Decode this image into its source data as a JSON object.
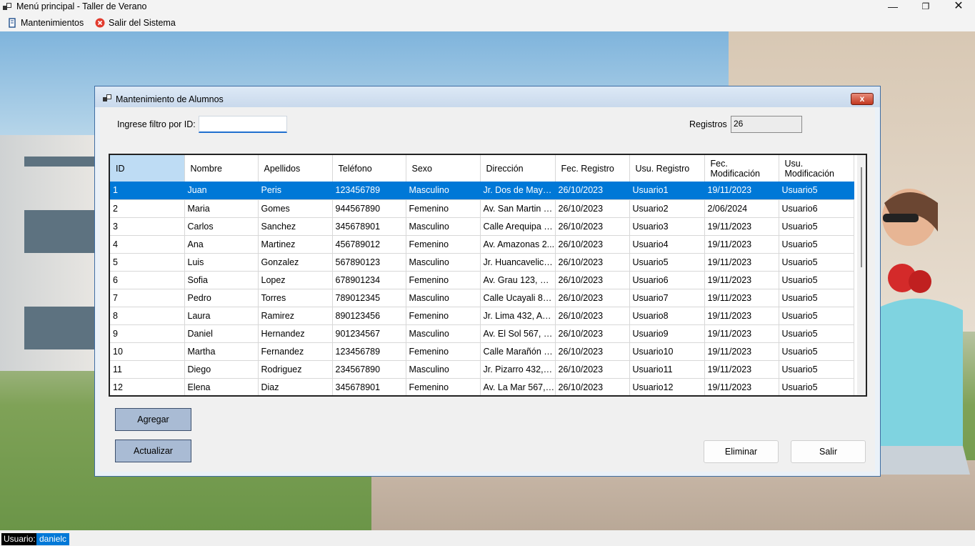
{
  "window": {
    "title": "Menú principal - Taller de Verano",
    "controls": {
      "minimize": "—",
      "maximize": "❐",
      "close": "✕"
    }
  },
  "menu": {
    "items": [
      {
        "label": "Mantenimientos",
        "icon": "book-icon"
      },
      {
        "label": "Salir del Sistema",
        "icon": "exit-icon"
      }
    ]
  },
  "dialog": {
    "title": "Mantenimiento de Alumnos",
    "close_label": "x",
    "filter_label": "Ingrese filtro por ID:",
    "filter_value": "",
    "registros_label": "Registros",
    "registros_value": "26"
  },
  "grid": {
    "columns": [
      "ID",
      "Nombre",
      "Apellidos",
      "Teléfono",
      "Sexo",
      "Dirección",
      "Fec. Registro",
      "Usu. Registro",
      "Fec. Modificación",
      "Usu. Modificación"
    ],
    "rows": [
      [
        "1",
        "Juan",
        "Peris",
        "123456789",
        "Masculino",
        "Jr. Dos de Mayo ...",
        "26/10/2023",
        "Usuario1",
        "19/11/2023",
        "Usuario5"
      ],
      [
        "2",
        "Maria",
        "Gomes",
        "944567890",
        "Femenino",
        "Av. San Martin 2...",
        "26/10/2023",
        "Usuario2",
        "2/06/2024",
        "Usuario6"
      ],
      [
        "3",
        "Carlos",
        "Sanchez",
        "345678901",
        "Masculino",
        "Calle Arequipa 7...",
        "26/10/2023",
        "Usuario3",
        "19/11/2023",
        "Usuario5"
      ],
      [
        "4",
        "Ana",
        "Martinez",
        "456789012",
        "Femenino",
        "Av. Amazonas 2...",
        "26/10/2023",
        "Usuario4",
        "19/11/2023",
        "Usuario5"
      ],
      [
        "5",
        "Luis",
        "Gonzalez",
        "567890123",
        "Masculino",
        "Jr. Huancavelica ...",
        "26/10/2023",
        "Usuario5",
        "19/11/2023",
        "Usuario5"
      ],
      [
        "6",
        "Sofia",
        "Lopez",
        "678901234",
        "Femenino",
        "Av. Grau 123, Cu...",
        "26/10/2023",
        "Usuario6",
        "19/11/2023",
        "Usuario5"
      ],
      [
        "7",
        "Pedro",
        "Torres",
        "789012345",
        "Masculino",
        "Calle Ucayali 890...",
        "26/10/2023",
        "Usuario7",
        "19/11/2023",
        "Usuario5"
      ],
      [
        "8",
        "Laura",
        "Ramirez",
        "890123456",
        "Femenino",
        "Jr. Lima 432, Aya...",
        "26/10/2023",
        "Usuario8",
        "19/11/2023",
        "Usuario5"
      ],
      [
        "9",
        "Daniel",
        "Hernandez",
        "901234567",
        "Masculino",
        "Av. El Sol 567, C...",
        "26/10/2023",
        "Usuario9",
        "19/11/2023",
        "Usuario5"
      ],
      [
        "10",
        "Martha",
        "Fernandez",
        "123456789",
        "Femenino",
        "Calle Marañón 1...",
        "26/10/2023",
        "Usuario10",
        "19/11/2023",
        "Usuario5"
      ],
      [
        "11",
        "Diego",
        "Rodriguez",
        "234567890",
        "Masculino",
        "Jr. Pizarro 432, C...",
        "26/10/2023",
        "Usuario11",
        "19/11/2023",
        "Usuario5"
      ],
      [
        "12",
        "Elena",
        "Diaz",
        "345678901",
        "Femenino",
        "Av. La Mar 567, I...",
        "26/10/2023",
        "Usuario12",
        "19/11/2023",
        "Usuario5"
      ]
    ],
    "selected_row": 0
  },
  "buttons": {
    "agregar": "Agregar",
    "actualizar": "Actualizar",
    "eliminar": "Eliminar",
    "salir": "Salir"
  },
  "status": {
    "label": "Usuario:",
    "user": "danielc"
  },
  "colors": {
    "selection": "#0078d7",
    "dialog_border": "#3f6ea3",
    "action_button": "#a9bbd4",
    "id_header": "#bedcf4"
  }
}
